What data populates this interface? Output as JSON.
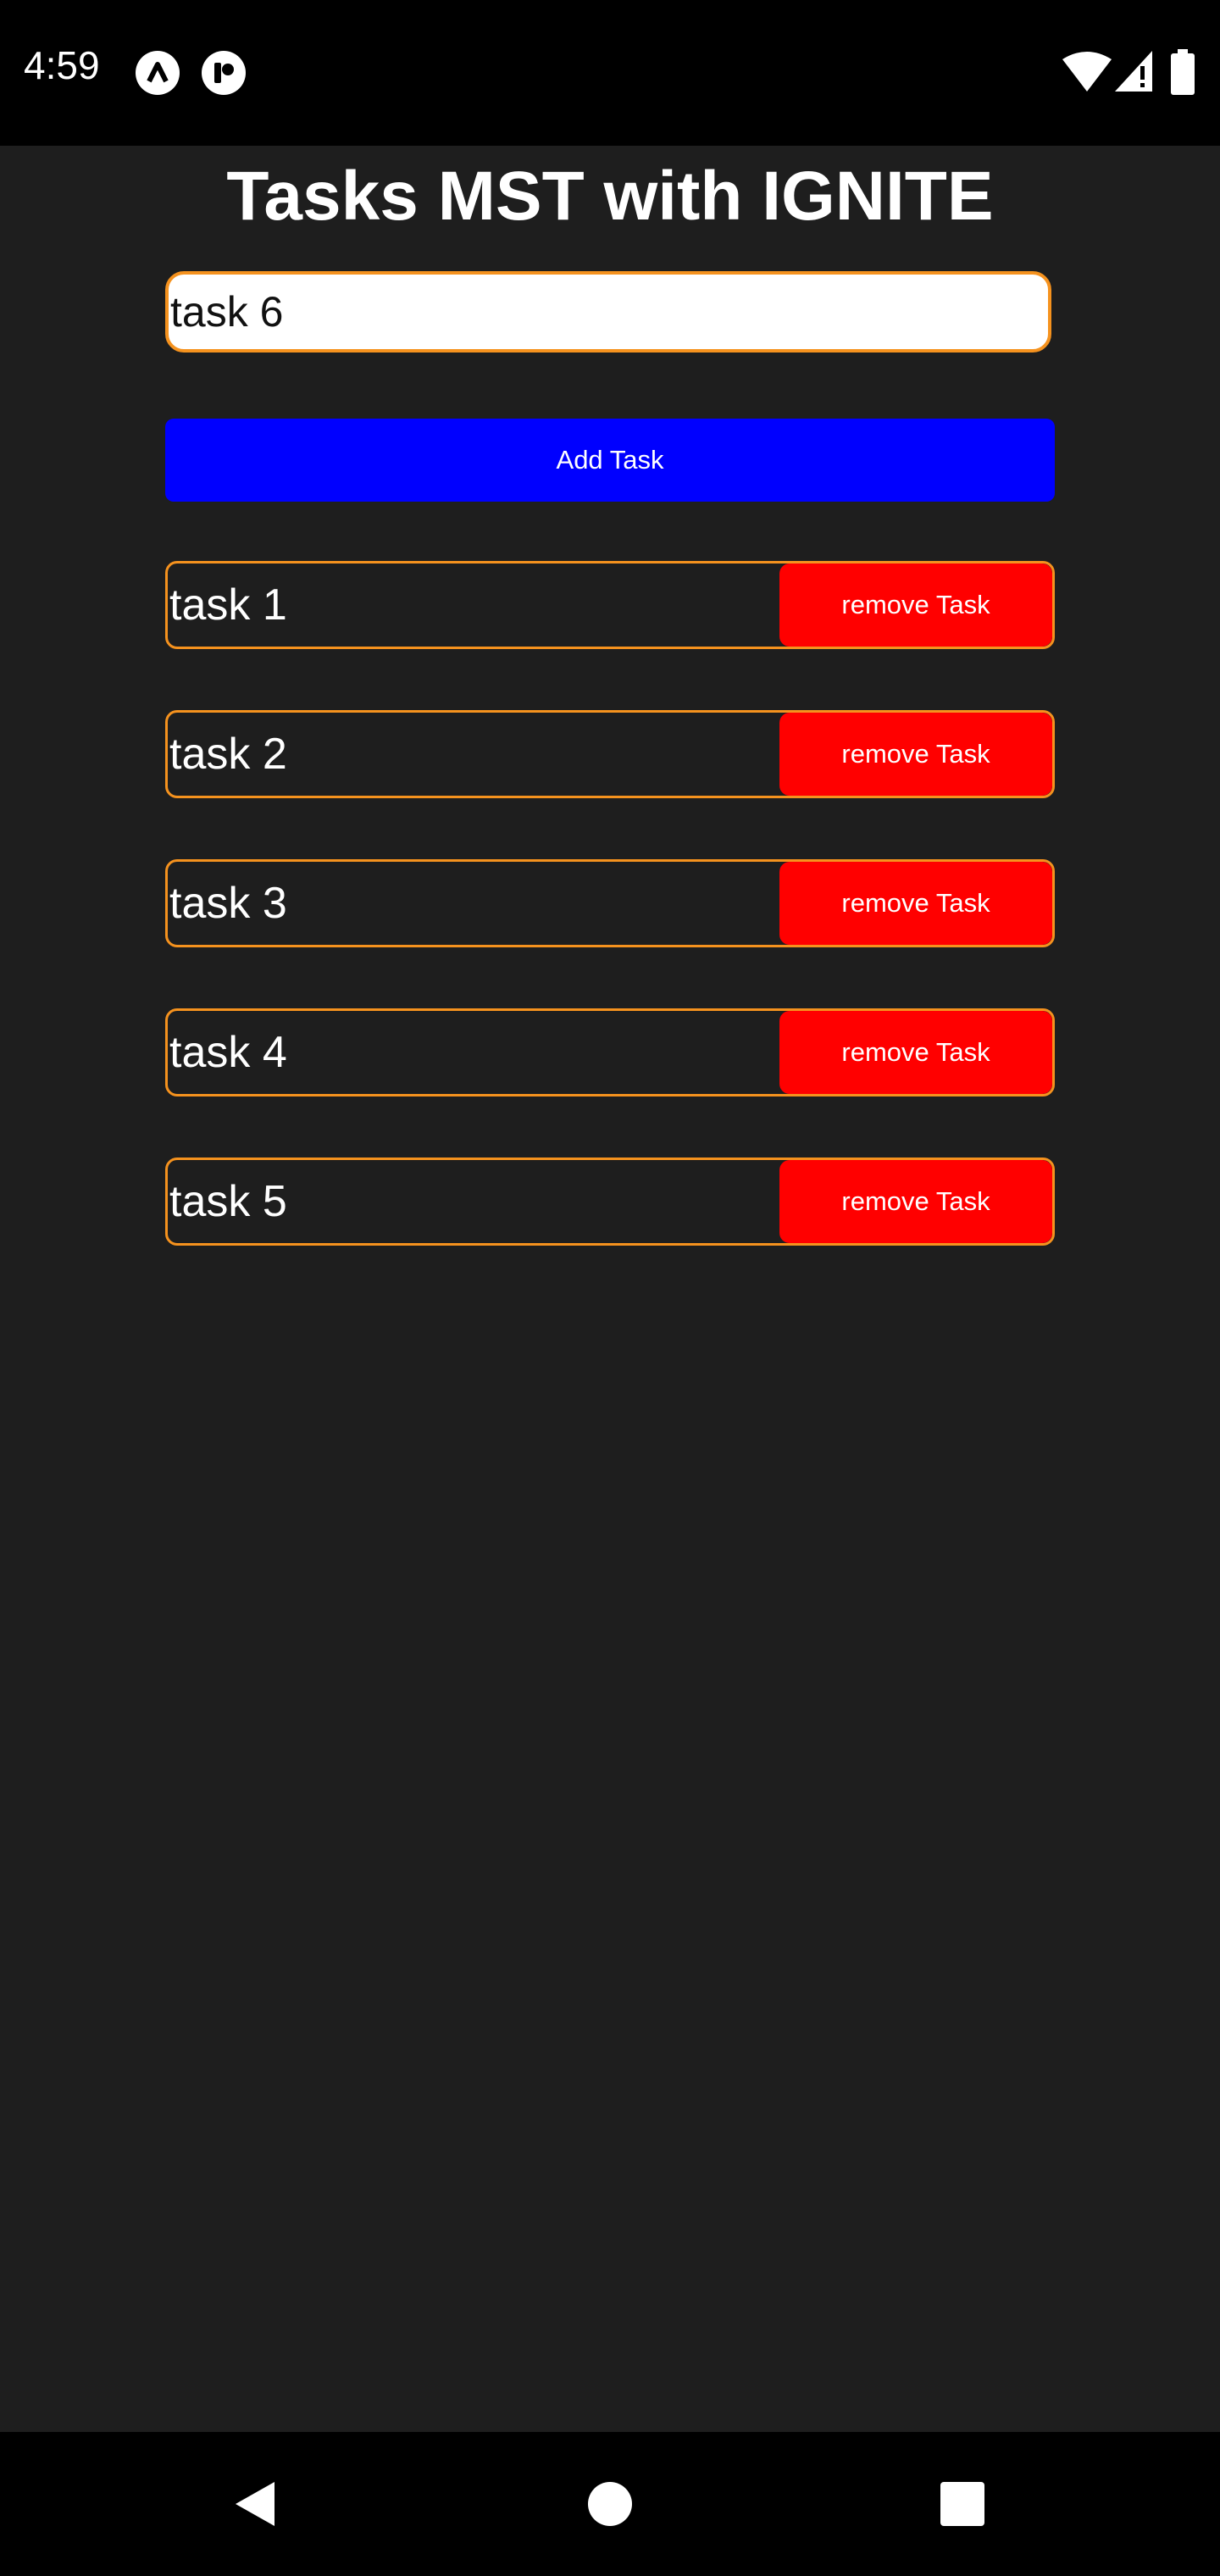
{
  "status_bar": {
    "time": "4:59",
    "icons": [
      "app-a-icon",
      "app-t-icon",
      "wifi-icon",
      "signal-icon",
      "battery-icon"
    ]
  },
  "header": {
    "title": "Tasks MST with IGNITE"
  },
  "input": {
    "value": "task 6",
    "placeholder": ""
  },
  "add_button": {
    "label": "Add Task"
  },
  "tasks": [
    {
      "label": "task 1",
      "remove_label": "remove Task"
    },
    {
      "label": "task 2",
      "remove_label": "remove Task"
    },
    {
      "label": "task 3",
      "remove_label": "remove Task"
    },
    {
      "label": "task 4",
      "remove_label": "remove Task"
    },
    {
      "label": "task 5",
      "remove_label": "remove Task"
    }
  ],
  "nav_bar": {
    "icons": [
      "back-icon",
      "home-icon",
      "recents-icon"
    ]
  },
  "colors": {
    "background": "#1e1e1e",
    "bars": "#000000",
    "accent_border": "#f5921e",
    "add_button": "#0000ff",
    "remove_button": "#ff0000"
  }
}
